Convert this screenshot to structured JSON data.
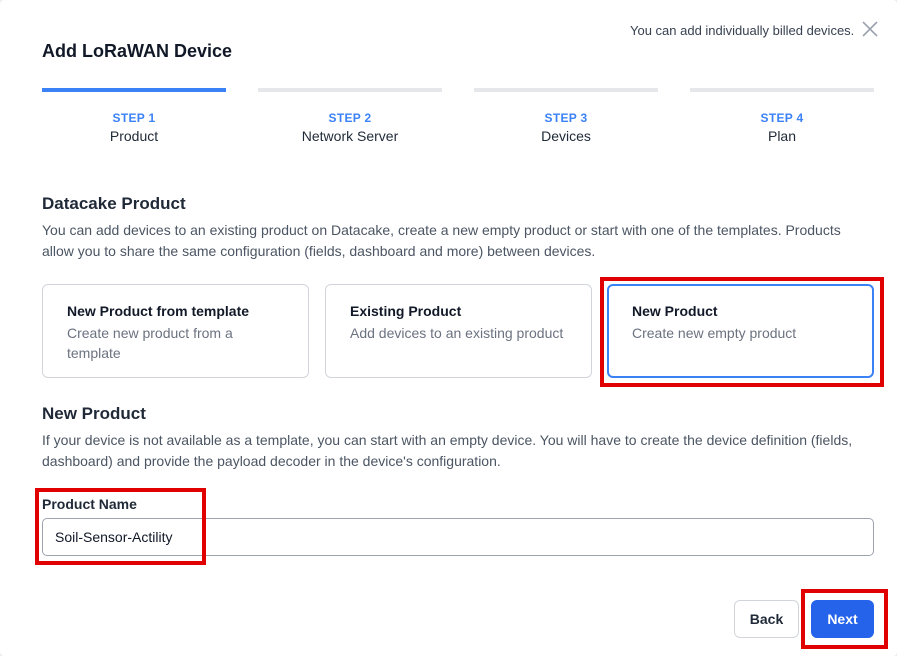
{
  "header": {
    "title": "Add LoRaWAN Device",
    "billing_note": "You can add individually billed devices."
  },
  "steps": [
    {
      "step": "STEP 1",
      "label": "Product"
    },
    {
      "step": "STEP 2",
      "label": "Network Server"
    },
    {
      "step": "STEP 3",
      "label": "Devices"
    },
    {
      "step": "STEP 4",
      "label": "Plan"
    }
  ],
  "active_step": 1,
  "product_section": {
    "title": "Datacake Product",
    "description": "You can add devices to an existing product on Datacake, create a new empty product or start with one of the templates. Products allow you to share the same configuration (fields, dashboard and more) between devices."
  },
  "options": [
    {
      "title": "New Product from template",
      "description": "Create new product from a template"
    },
    {
      "title": "Existing Product",
      "description": "Add devices to an existing product"
    },
    {
      "title": "New Product",
      "description": "Create new empty product"
    }
  ],
  "selected_option": "New Product",
  "new_product": {
    "title": "New Product",
    "description": "If your device is not available as a template, you can start with an empty device. You will have to create the device definition (fields, dashboard) and provide the payload decoder in the device's configuration.",
    "field_label": "Product Name",
    "field_value": "Soil-Sensor-Actility"
  },
  "buttons": {
    "back": "Back",
    "next": "Next"
  },
  "colors": {
    "accent": "#3b82f6",
    "primary_button": "#2563eb",
    "highlight": "#e00000"
  }
}
